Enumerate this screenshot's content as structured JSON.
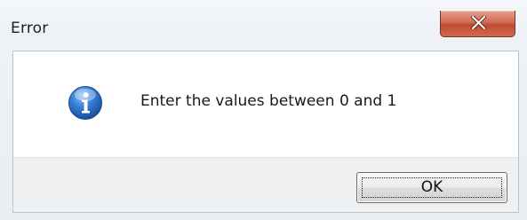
{
  "dialog": {
    "title": "Error",
    "message": "Enter the values between 0 and 1",
    "icon": "information-icon",
    "ok_label": "OK",
    "close_icon": "close-icon"
  },
  "colors": {
    "close_button": "#c9553c",
    "info_icon": "#2a6fc9",
    "button_strip": "#eff0f1"
  }
}
